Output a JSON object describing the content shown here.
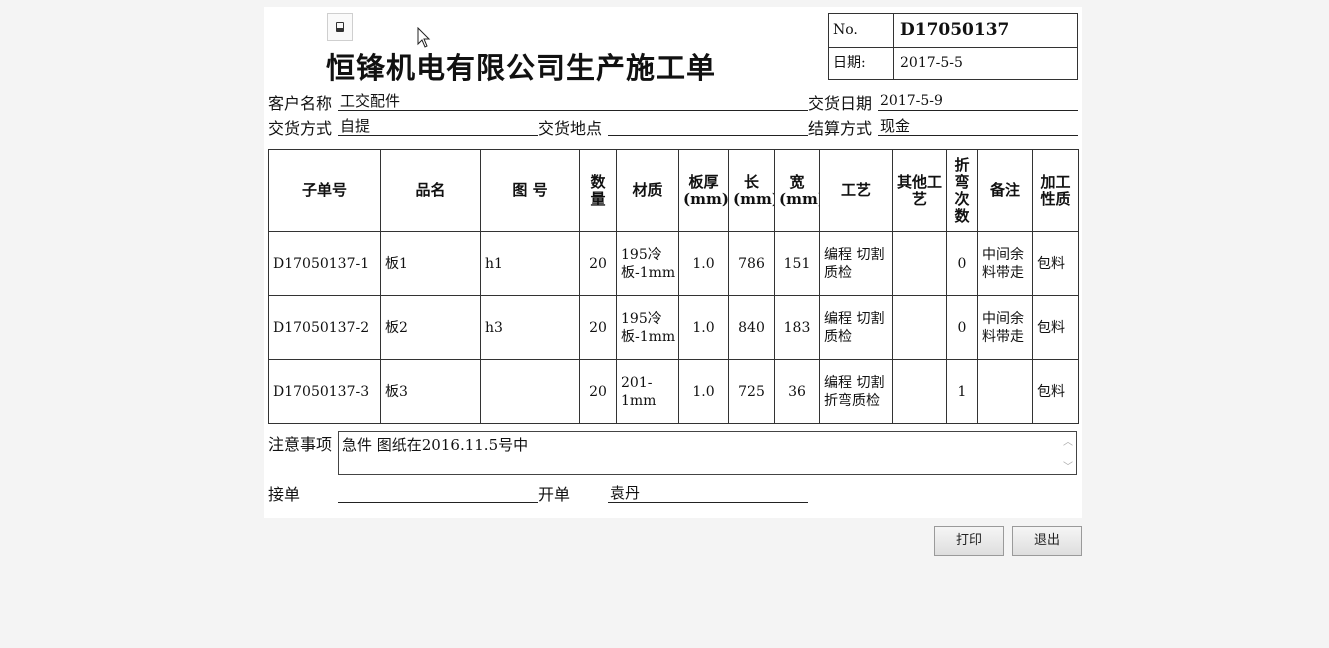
{
  "header": {
    "title": "恒锋机电有限公司生产施工单",
    "no_label": "No.",
    "no_value": "D17050137",
    "date_label": "日期:",
    "date_value": "2017-5-5"
  },
  "fields": {
    "customer_label": "客户名称",
    "customer_value": "工交配件",
    "delivery_date_label": "交货日期",
    "delivery_date_value": "2017-5-9",
    "delivery_method_label": "交货方式",
    "delivery_method_value": "自提",
    "delivery_place_label": "交货地点",
    "delivery_place_value": "",
    "settlement_label": "结算方式",
    "settlement_value": "现金"
  },
  "table": {
    "headers": [
      "子单号",
      "品名",
      "图 号",
      "数量",
      "材质",
      "板厚(mm)",
      "长(mm)",
      "宽(mm)",
      "工艺",
      "其他工艺",
      "折弯次数",
      "备注",
      "加工性质"
    ],
    "rows": [
      [
        "D17050137-1",
        "板1",
        "h1",
        "20",
        "195冷板-1mm",
        "1.0",
        "786",
        "151",
        "编程 切割 质检",
        "",
        "0",
        "中间余料带走",
        "包料"
      ],
      [
        "D17050137-2",
        "板2",
        "h3",
        "20",
        "195冷板-1mm",
        "1.0",
        "840",
        "183",
        "编程 切割 质检",
        "",
        "0",
        "中间余料带走",
        "包料"
      ],
      [
        "D17050137-3",
        "板3",
        "",
        "20",
        "201-1mm",
        "1.0",
        "725",
        "36",
        "编程 切割 折弯质检",
        "",
        "1",
        "",
        "包料"
      ]
    ]
  },
  "notes": {
    "label": "注意事项",
    "value": "急件 图纸在2016.11.5号中"
  },
  "footer": {
    "receiver_label": "接单",
    "receiver_value": "",
    "issuer_label": "开单",
    "issuer_value": "袁丹"
  },
  "buttons": {
    "print_label": "打印",
    "exit_label": "退出"
  },
  "icons": {
    "print_icon": "printer-icon",
    "cursor": "mouse-cursor-icon"
  }
}
